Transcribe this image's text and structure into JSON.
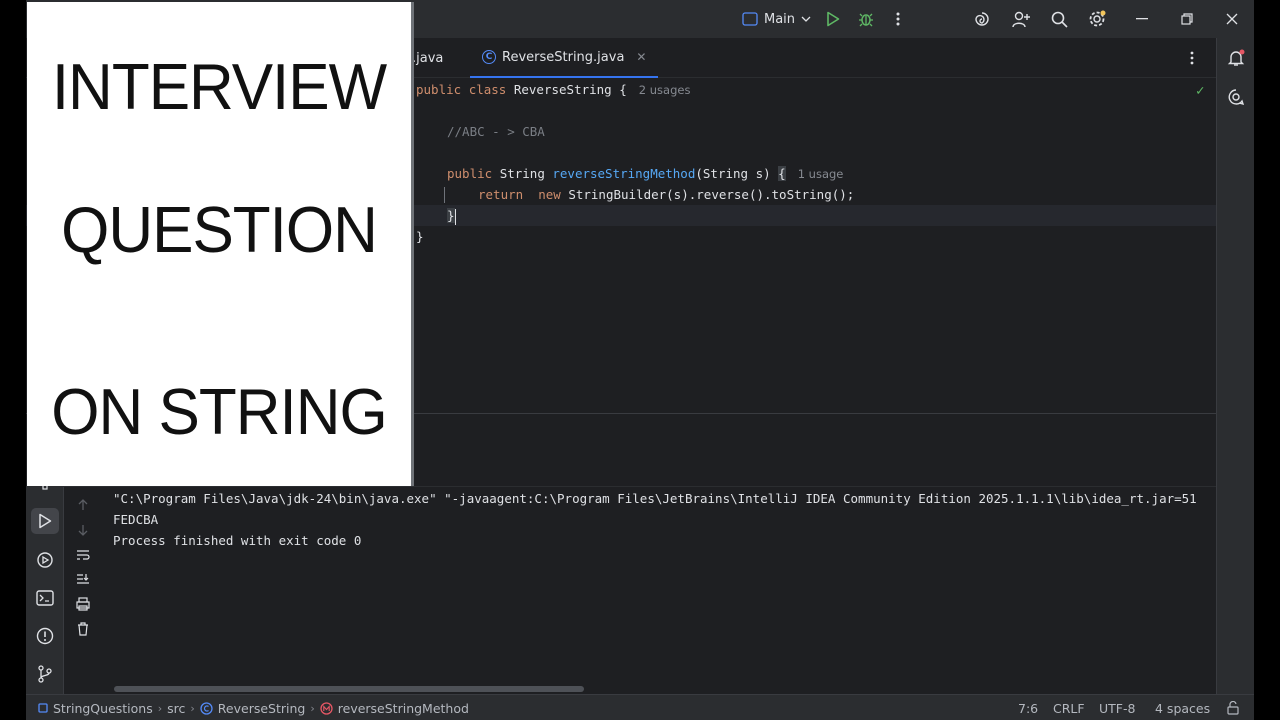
{
  "titlebar": {
    "run_config": "Main",
    "colors": {
      "run": "#5fb865",
      "debug": "#5fb865",
      "accent": "#3574f0"
    }
  },
  "tabs": [
    {
      "label": ".java",
      "active": false
    },
    {
      "label": "ReverseString.java",
      "active": true,
      "icon_letter": "C"
    }
  ],
  "editor": {
    "line1": {
      "kw1": "public",
      "kw2": "class",
      "name": "ReverseString",
      "brace": "{",
      "hint": "2 usages"
    },
    "line3": {
      "comment": "//ABC - > CBA"
    },
    "line5": {
      "kw": "public",
      "type": "String",
      "method": "reverseStringMethod",
      "params": "(String s)",
      "brace": "{",
      "hint": "1 usage"
    },
    "line6": {
      "kw1": "return",
      "kw2": "new",
      "rest": "StringBuilder(s).reverse().toString();"
    },
    "line7": {
      "brace": "}"
    },
    "line8": {
      "brace": "}"
    }
  },
  "console": {
    "lines": [
      "\"C:\\Program Files\\Java\\jdk-24\\bin\\java.exe\" \"-javaagent:C:\\Program Files\\JetBrains\\IntelliJ IDEA Community Edition 2025.1.1.1\\lib\\idea_rt.jar=51",
      "FEDCBA",
      "Process finished with exit code 0"
    ]
  },
  "statusbar": {
    "project": "StringQuestions",
    "folder": "src",
    "class": "ReverseString",
    "method": "reverseStringMethod",
    "position": "7:6",
    "line_sep": "CRLF",
    "encoding": "UTF-8",
    "indent": "4 spaces"
  },
  "overlay": {
    "line1": "INTERVIEW",
    "line2": "QUESTION",
    "line3": "ON STRING"
  }
}
